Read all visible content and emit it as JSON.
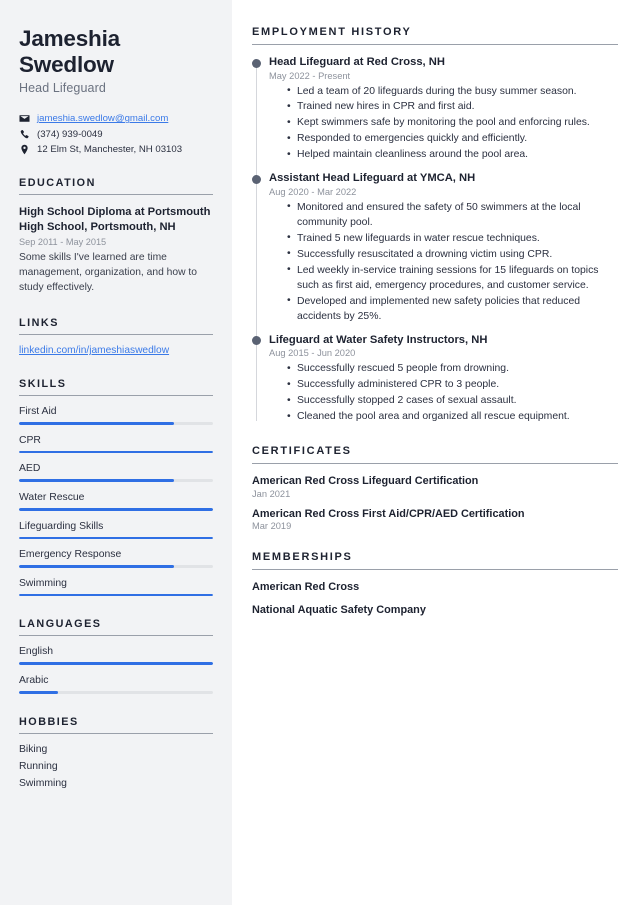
{
  "theme": {
    "accent": "#2f6fe4",
    "link": "#3b7ae8",
    "sidebar_bg": "#f2f3f5",
    "heading": "#1d2230",
    "muted": "#8d929c",
    "timeline_dot": "#5a6273"
  },
  "sidebar": {
    "name": "Jameshia Swedlow",
    "job_title": "Head Lifeguard",
    "contacts": [
      {
        "icon": "envelope-icon",
        "text": "jameshia.swedlow@gmail.com",
        "is_link": true
      },
      {
        "icon": "phone-icon",
        "text": "(374) 939-0049",
        "is_link": false
      },
      {
        "icon": "location-pin-icon",
        "text": "12 Elm St, Manchester, NH 03103",
        "is_link": false
      }
    ],
    "education": {
      "heading": "EDUCATION",
      "items": [
        {
          "title": "High School Diploma at Portsmouth High School, Portsmouth, NH",
          "date": "Sep 2011 - May 2015",
          "description": "Some skills I've learned are time management, organization, and how to study effectively."
        }
      ]
    },
    "links": {
      "heading": "LINKS",
      "items": [
        {
          "label": "linkedin.com/in/jameshiaswedlow"
        }
      ]
    },
    "skills": {
      "heading": "SKILLS",
      "items": [
        {
          "label": "First Aid",
          "level": 80
        },
        {
          "label": "CPR",
          "level": 100
        },
        {
          "label": "AED",
          "level": 80
        },
        {
          "label": "Water Rescue",
          "level": 100
        },
        {
          "label": "Lifeguarding Skills",
          "level": 100
        },
        {
          "label": "Emergency Response",
          "level": 80
        },
        {
          "label": "Swimming",
          "level": 100
        }
      ]
    },
    "languages": {
      "heading": "LANGUAGES",
      "items": [
        {
          "label": "English",
          "level": 100
        },
        {
          "label": "Arabic",
          "level": 20
        }
      ]
    },
    "hobbies": {
      "heading": "HOBBIES",
      "items": [
        {
          "label": "Biking"
        },
        {
          "label": "Running"
        },
        {
          "label": "Swimming"
        }
      ]
    }
  },
  "main": {
    "employment": {
      "heading": "EMPLOYMENT HISTORY",
      "jobs": [
        {
          "title": "Head Lifeguard at Red Cross, NH",
          "date": "May 2022 - Present",
          "bullets": [
            "Led a team of 20 lifeguards during the busy summer season.",
            "Trained new hires in CPR and first aid.",
            "Kept swimmers safe by monitoring the pool and enforcing rules.",
            "Responded to emergencies quickly and efficiently.",
            "Helped maintain cleanliness around the pool area."
          ]
        },
        {
          "title": "Assistant Head Lifeguard at YMCA, NH",
          "date": "Aug 2020 - Mar 2022",
          "bullets": [
            "Monitored and ensured the safety of 50 swimmers at the local community pool.",
            "Trained 5 new lifeguards in water rescue techniques.",
            "Successfully resuscitated a drowning victim using CPR.",
            "Led weekly in-service training sessions for 15 lifeguards on topics such as first aid, emergency procedures, and customer service.",
            "Developed and implemented new safety policies that reduced accidents by 25%."
          ]
        },
        {
          "title": "Lifeguard at Water Safety Instructors, NH",
          "date": "Aug 2015 - Jun 2020",
          "bullets": [
            "Successfully rescued 5 people from drowning.",
            "Successfully administered CPR to 3 people.",
            "Successfully stopped 2 cases of sexual assault.",
            "Cleaned the pool area and organized all rescue equipment."
          ]
        }
      ]
    },
    "certificates": {
      "heading": "CERTIFICATES",
      "items": [
        {
          "name": "American Red Cross Lifeguard Certification",
          "date": "Jan 2021"
        },
        {
          "name": "American Red Cross First Aid/CPR/AED Certification",
          "date": "Mar 2019"
        }
      ]
    },
    "memberships": {
      "heading": "MEMBERSHIPS",
      "items": [
        {
          "name": "American Red Cross"
        },
        {
          "name": "National Aquatic Safety Company"
        }
      ]
    }
  }
}
